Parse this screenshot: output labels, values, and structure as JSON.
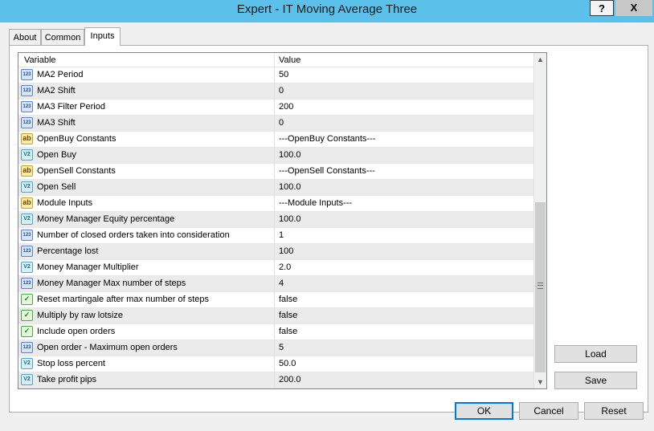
{
  "window": {
    "title": "Expert - IT Moving Average Three",
    "help_label": "?",
    "close_label": "X"
  },
  "tabs": [
    {
      "label": "About"
    },
    {
      "label": "Common"
    },
    {
      "label": "Inputs",
      "active": true
    }
  ],
  "grid": {
    "columns": {
      "variable": "Variable",
      "value": "Value"
    },
    "rows": [
      {
        "type": "int",
        "icon_text": "123",
        "name": "MA2 Period",
        "value": "50"
      },
      {
        "type": "int",
        "icon_text": "123",
        "name": "MA2 Shift",
        "value": "0"
      },
      {
        "type": "int",
        "icon_text": "123",
        "name": "MA3 Filter Period",
        "value": "200"
      },
      {
        "type": "int",
        "icon_text": "123",
        "name": "MA3 Shift",
        "value": "0"
      },
      {
        "type": "string",
        "icon_text": "ab",
        "name": "OpenBuy Constants",
        "value": "---OpenBuy Constants---"
      },
      {
        "type": "double",
        "icon_text": "V2",
        "name": "Open Buy",
        "value": "100.0"
      },
      {
        "type": "string",
        "icon_text": "ab",
        "name": "OpenSell Constants",
        "value": "---OpenSell Constants---"
      },
      {
        "type": "double",
        "icon_text": "V2",
        "name": "Open Sell",
        "value": "100.0"
      },
      {
        "type": "string",
        "icon_text": "ab",
        "name": "Module Inputs",
        "value": "---Module Inputs---"
      },
      {
        "type": "double",
        "icon_text": "V2",
        "name": "Money Manager Equity percentage",
        "value": "100.0"
      },
      {
        "type": "int",
        "icon_text": "123",
        "name": "Number of closed orders taken into consideration",
        "value": "1"
      },
      {
        "type": "int",
        "icon_text": "123",
        "name": "Percentage lost",
        "value": "100"
      },
      {
        "type": "double",
        "icon_text": "V2",
        "name": "Money Manager Multiplier",
        "value": "2.0"
      },
      {
        "type": "int",
        "icon_text": "123",
        "name": "Money Manager Max number of steps",
        "value": "4"
      },
      {
        "type": "bool",
        "icon_text": "✓",
        "name": "Reset martingale after max number of steps",
        "value": "false"
      },
      {
        "type": "bool",
        "icon_text": "✓",
        "name": "Multiply by raw lotsize",
        "value": "false"
      },
      {
        "type": "bool",
        "icon_text": "✓",
        "name": "Include open orders",
        "value": "false"
      },
      {
        "type": "int",
        "icon_text": "123",
        "name": "Open order - Maximum open orders",
        "value": "5"
      },
      {
        "type": "double",
        "icon_text": "V2",
        "name": "Stop loss percent",
        "value": "50.0"
      },
      {
        "type": "double",
        "icon_text": "V2",
        "name": "Take profit pips",
        "value": "200.0"
      }
    ],
    "scroll_position": 0.75
  },
  "side_buttons": {
    "load": "Load",
    "save": "Save"
  },
  "footer_buttons": {
    "ok": "OK",
    "cancel": "Cancel",
    "reset": "Reset"
  },
  "colors": {
    "title_bar": "#5bc1ea",
    "ok_border": "#0078d7"
  }
}
